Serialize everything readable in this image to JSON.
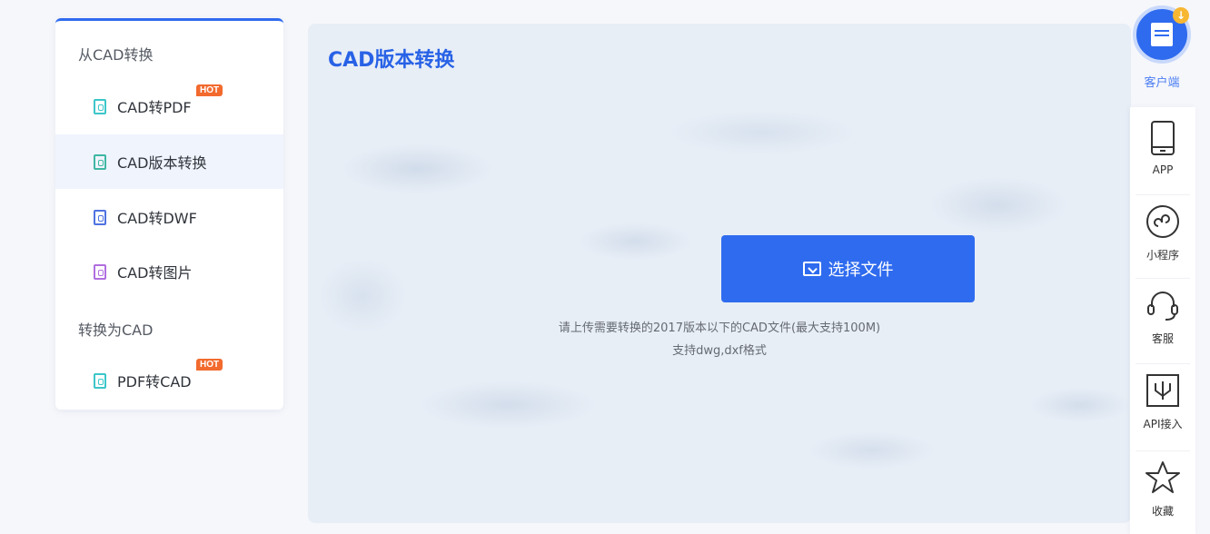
{
  "sidebar": {
    "group_from": "从CAD转换",
    "group_to": "转换为CAD",
    "items": [
      {
        "label": "CAD转PDF",
        "hot": "HOT",
        "icon_color": "#3bc6c9"
      },
      {
        "label": "CAD版本转换",
        "icon_color": "#3fb7a3"
      },
      {
        "label": "CAD转DWF",
        "icon_color": "#4f72e0"
      },
      {
        "label": "CAD转图片",
        "icon_color": "#b06ee0"
      },
      {
        "label": "PDF转CAD",
        "hot": "HOT",
        "icon_color": "#3bc6c9"
      }
    ]
  },
  "main": {
    "title": "CAD版本转换",
    "button_label": "选择文件",
    "hint_line1": "请上传需要转换的2017版本以下的CAD文件(最大支持100M)",
    "hint_line2": "支持dwg,dxf格式"
  },
  "rail": {
    "client_label": "客户端",
    "client_badge": "↓",
    "items": [
      {
        "label": "APP",
        "icon": "phone-icon"
      },
      {
        "label": "小程序",
        "icon": "mini-program-icon"
      },
      {
        "label": "客服",
        "icon": "headset-icon"
      },
      {
        "label": "API接入",
        "icon": "api-icon"
      },
      {
        "label": "收藏",
        "icon": "star-icon"
      }
    ]
  },
  "colors": {
    "accent": "#2f6bef",
    "hot": "#f26a2e",
    "title": "#2862e6"
  }
}
